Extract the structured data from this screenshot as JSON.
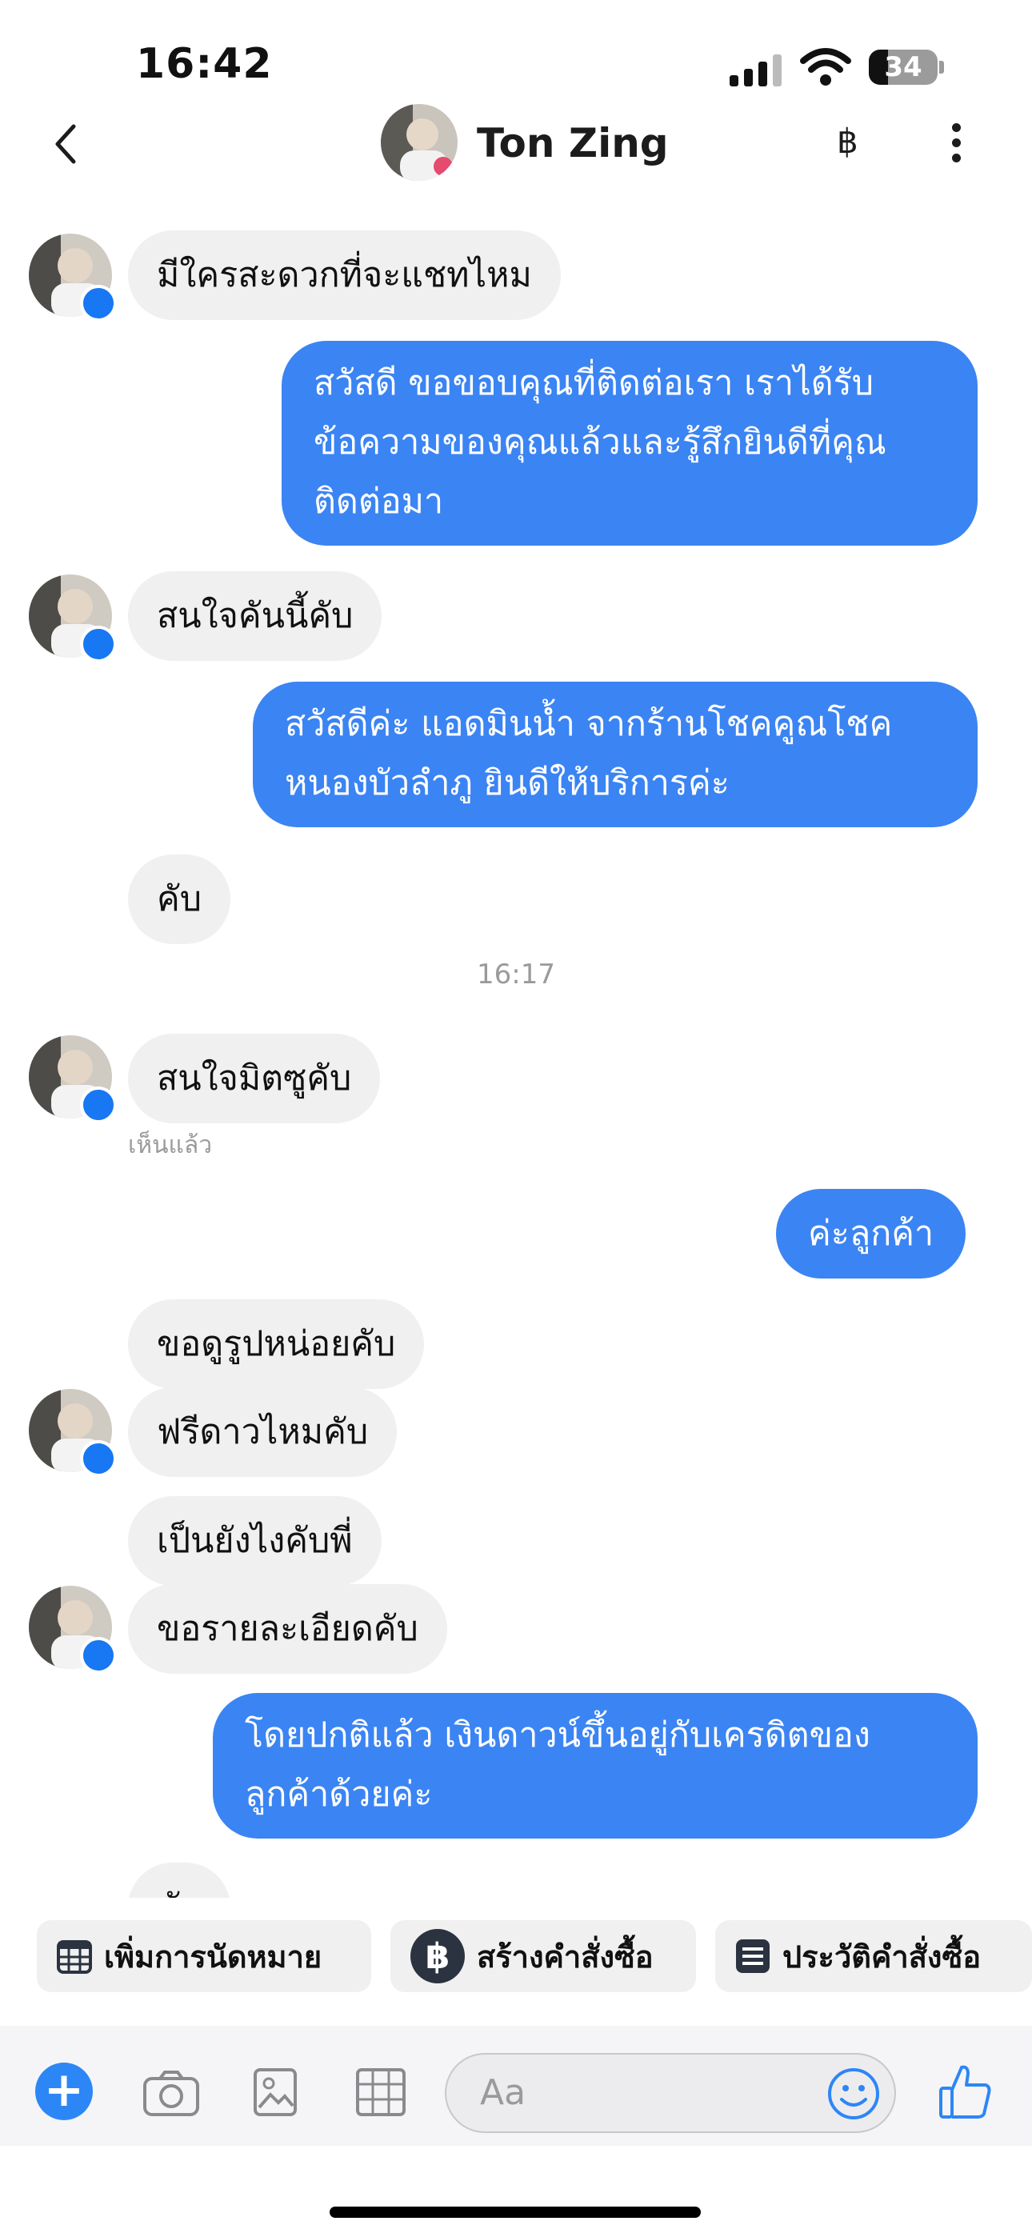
{
  "status_bar": {
    "time": "16:42",
    "battery": "34"
  },
  "header": {
    "contact_name": "Ton Zing",
    "currency_symbol": "฿"
  },
  "messages": [
    {
      "dir": "in",
      "text": "มีใครสะดวกที่จะแชทไหม"
    },
    {
      "dir": "out",
      "lines": [
        "สวัสดี ขอขอบคุณที่ติดต่อเรา เราได้รับ",
        "ข้อความของคุณแล้วและรู้สึกยินดีที่คุณ",
        "ติดต่อมา"
      ]
    },
    {
      "dir": "in",
      "text": "สนใจคันนี้คับ"
    },
    {
      "dir": "out",
      "lines": [
        "สวัสดีค่ะ แอดมินน้ำ จากร้านโชคคูณโชค",
        "หนองบัวลำภู ยินดีให้บริการค่ะ"
      ]
    },
    {
      "dir": "in",
      "text": "คับ"
    },
    {
      "dir": "in",
      "text": "สนใจมิตซูคับ"
    },
    {
      "dir": "out",
      "text": "ค่ะลูกค้า"
    },
    {
      "dir": "in",
      "text": "ขอดูรูปหน่อยคับ"
    },
    {
      "dir": "in",
      "text": "ฟรีดาวไหมคับ"
    },
    {
      "dir": "in",
      "text": "เป็นยังไงคับพี่"
    },
    {
      "dir": "in",
      "text": "ขอรายละเอียดคับ"
    },
    {
      "dir": "out",
      "lines": [
        "โดยปกติแล้ว เงินดาวน์ขึ้นอยู่กับเครดิตของ",
        "ลูกค้าด้วยค่ะ"
      ]
    },
    {
      "dir": "in",
      "text": "คับ"
    }
  ],
  "time_separator": "16:17",
  "seen_label": "เห็นแล้ว",
  "quick_replies": [
    {
      "label": "เพิ่มการนัดหมาย",
      "icon": "calendar-icon"
    },
    {
      "label": "สร้างคำสั่งซื้อ",
      "icon": "baht-circle-icon"
    },
    {
      "label": "ประวัติคำสั่งซื้อ",
      "icon": "list-icon"
    }
  ],
  "composer": {
    "placeholder": "Aa"
  }
}
